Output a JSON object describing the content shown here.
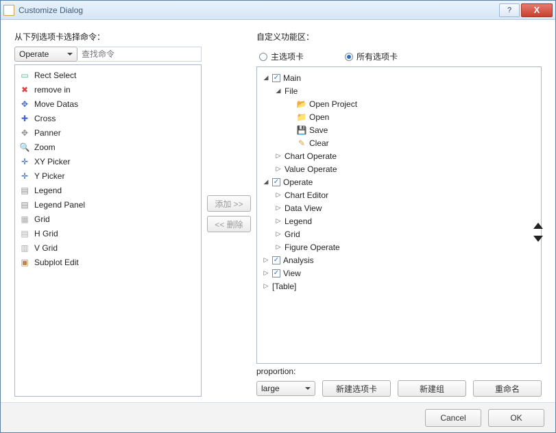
{
  "window": {
    "title": "Customize Dialog",
    "help": "?",
    "close": "X"
  },
  "left": {
    "label": "从下列选项卡选择命令：",
    "dropdown": "Operate",
    "search_placeholder": "查找命令",
    "items": [
      {
        "label": "Rect Select",
        "icon": "▭",
        "color": "#4a8"
      },
      {
        "label": "remove in",
        "icon": "✖",
        "color": "#d44"
      },
      {
        "label": "Move Datas",
        "icon": "✥",
        "color": "#46c"
      },
      {
        "label": "Cross",
        "icon": "✚",
        "color": "#46c"
      },
      {
        "label": "Panner",
        "icon": "✥",
        "color": "#888"
      },
      {
        "label": "Zoom",
        "icon": "🔍",
        "color": "#555"
      },
      {
        "label": "XY Picker",
        "icon": "✛",
        "color": "#36a"
      },
      {
        "label": "Y Picker",
        "icon": "✛",
        "color": "#36a"
      },
      {
        "label": "Legend",
        "icon": "▤",
        "color": "#888"
      },
      {
        "label": "Legend Panel",
        "icon": "▤",
        "color": "#888"
      },
      {
        "label": "Grid",
        "icon": "▦",
        "color": "#aaa"
      },
      {
        "label": "H Grid",
        "icon": "▤",
        "color": "#aaa"
      },
      {
        "label": "V Grid",
        "icon": "▥",
        "color": "#aaa"
      },
      {
        "label": "Subplot Edit",
        "icon": "▣",
        "color": "#b84"
      }
    ]
  },
  "mid": {
    "add": "添加 >>",
    "remove": "<< 删除"
  },
  "right": {
    "label": "自定义功能区：",
    "radio_main": "主选项卡",
    "radio_all": "所有选项卡",
    "tree": {
      "main": "Main",
      "file": "File",
      "file_children": [
        {
          "label": "Open Project",
          "icon": "📂",
          "color": "#e6a23c"
        },
        {
          "label": "Open",
          "icon": "📁",
          "color": "#e6a23c"
        },
        {
          "label": "Save",
          "icon": "💾",
          "color": "#5a7fd0"
        },
        {
          "label": "Clear",
          "icon": "✎",
          "color": "#d4a24c"
        }
      ],
      "main_children": [
        "Chart Operate",
        "Value Operate"
      ],
      "operate": "Operate",
      "operate_children": [
        "Chart Editor",
        "Data View",
        "Legend",
        "Grid",
        "Figure Operate"
      ],
      "roots_tail": [
        "Analysis",
        "View",
        "[Table]"
      ]
    },
    "proportion_label": "proportion:",
    "proportion_value": "large",
    "new_tab": "新建选项卡",
    "new_group": "新建组",
    "rename": "重命名"
  },
  "footer": {
    "cancel": "Cancel",
    "ok": "OK"
  }
}
